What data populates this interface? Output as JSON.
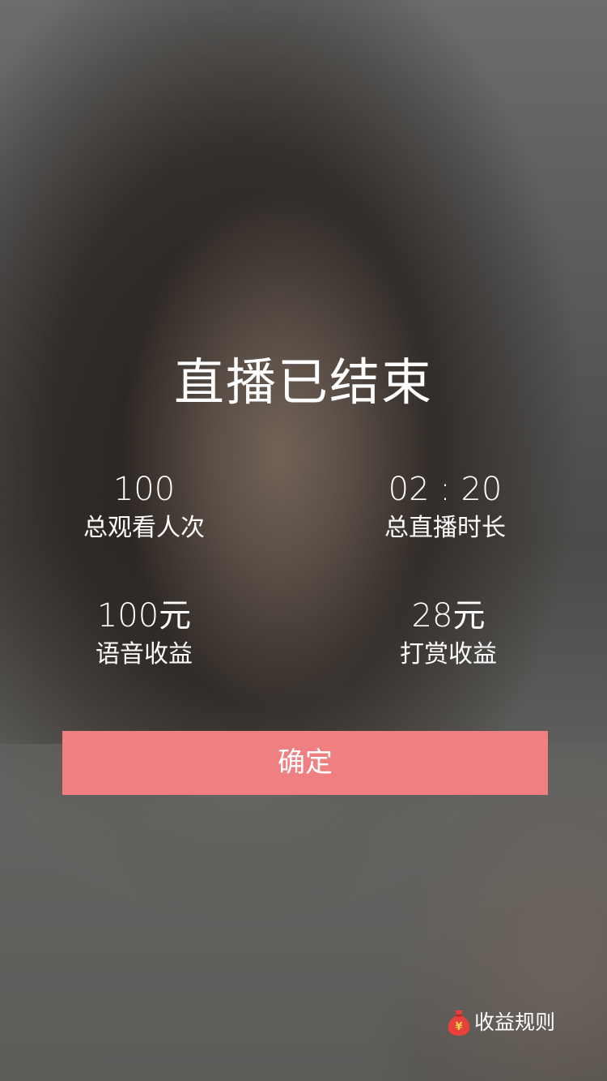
{
  "screen": {
    "title": "直播已结束"
  },
  "stats": {
    "viewers": {
      "value": "100",
      "label": "总观看人次"
    },
    "duration": {
      "value": "02 : 20",
      "label": "总直播时长"
    },
    "voice_income": {
      "value": "100元",
      "label": "语音收益"
    },
    "tip_income": {
      "value": "28元",
      "label": "打赏收益"
    }
  },
  "actions": {
    "confirm_label": "确定",
    "rules_label": "收益规则",
    "rules_icon": "money-bag-icon",
    "money_bag_glyph": "¥"
  },
  "colors": {
    "confirm_button": "#f07f82",
    "money_bag": "#e8413b"
  }
}
